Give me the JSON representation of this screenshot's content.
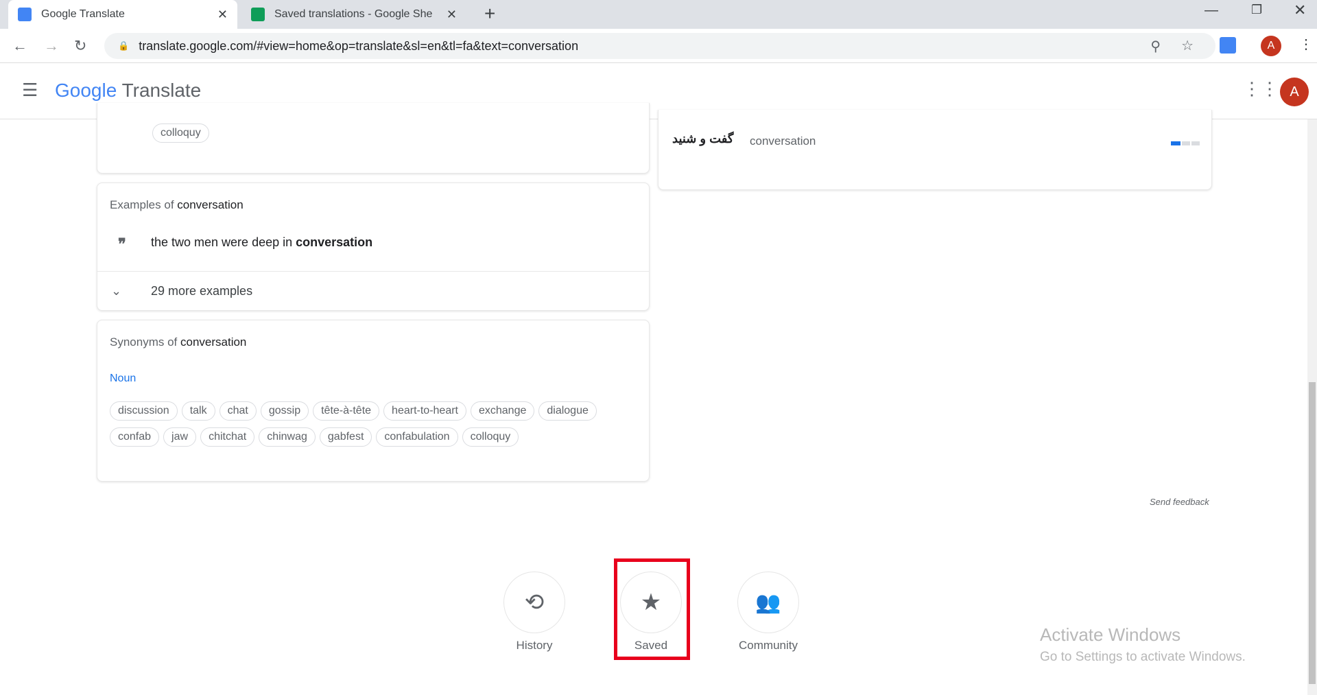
{
  "browser": {
    "tabs": [
      {
        "title": "Google Translate",
        "icon": "google-translate-icon",
        "active": true
      },
      {
        "title": "Saved translations - Google She",
        "icon": "google-sheets-icon",
        "active": false
      }
    ],
    "url": "translate.google.com/#view=home&op=translate&sl=en&tl=fa&text=conversation",
    "avatar_letter": "A"
  },
  "app": {
    "logo_google": "Google",
    "logo_product": "Translate",
    "avatar_letter": "A"
  },
  "top_card": {
    "chip": "colloquy"
  },
  "examples": {
    "heading_prefix": "Examples of ",
    "word": "conversation",
    "example_prefix": "the two men were deep in ",
    "example_bold": "conversation",
    "more": "29 more examples"
  },
  "synonyms": {
    "heading_prefix": "Synonyms of ",
    "word": "conversation",
    "pos": "Noun",
    "row1": [
      "discussion",
      "talk",
      "chat",
      "gossip",
      "tête-à-tête",
      "heart-to-heart",
      "exchange",
      "dialogue"
    ],
    "row2": [
      "confab",
      "jaw",
      "chitchat",
      "chinwag",
      "gabfest",
      "confabulation",
      "colloquy"
    ]
  },
  "translations": {
    "target": "گفت و شنید",
    "source": "conversation",
    "frequency": 0.33,
    "accent": "#1a73e8"
  },
  "send_feedback": "Send feedback",
  "bottom": [
    {
      "label": "History",
      "icon": "history-icon"
    },
    {
      "label": "Saved",
      "icon": "star-icon",
      "highlighted": true
    },
    {
      "label": "Community",
      "icon": "community-icon"
    }
  ],
  "highlight_color": "#e8001c",
  "watermark": {
    "title": "Activate Windows",
    "subtitle": "Go to Settings to activate Windows."
  }
}
